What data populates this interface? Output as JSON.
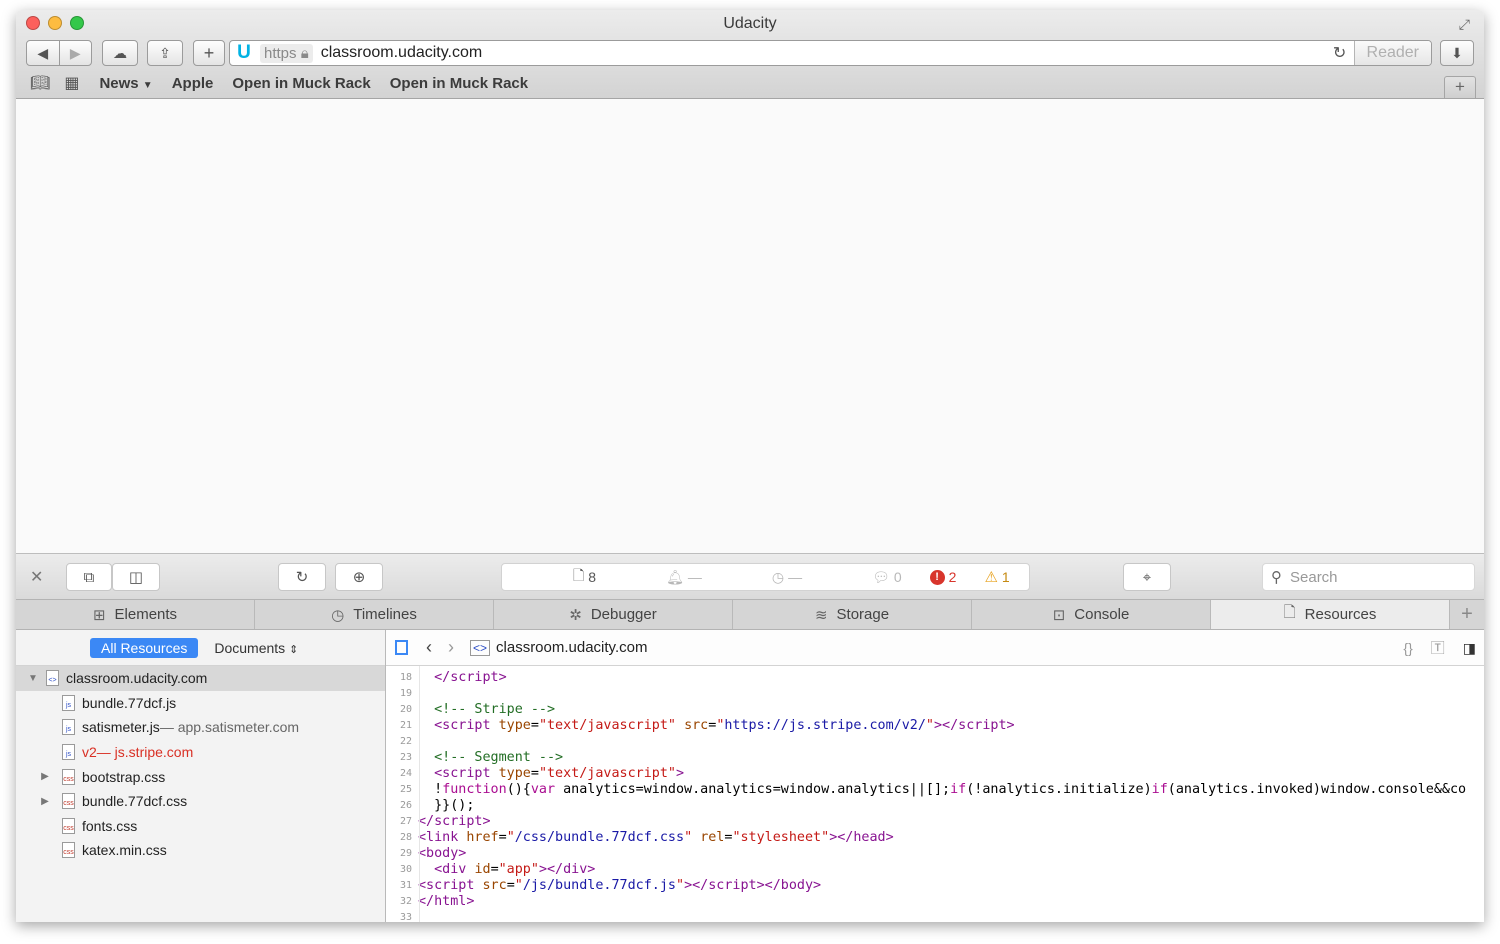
{
  "window": {
    "title": "Udacity",
    "colors": {
      "close": "#fc605c",
      "minimize": "#fdbc40",
      "zoom": "#34c84a"
    }
  },
  "toolbar": {
    "back_icon": "back-arrow-icon",
    "forward_icon": "forward-arrow-icon",
    "icloud_icon": "cloud-icon",
    "share_icon": "share-icon",
    "new_tab_icon": "plus-icon",
    "download_icon": "download-icon"
  },
  "address": {
    "scheme": "https",
    "url": "classroom.udacity.com",
    "reader_label": "Reader"
  },
  "bookmarks": {
    "items": [
      "News",
      "Apple",
      "Open in Muck Rack",
      "Open in Muck Rack"
    ]
  },
  "inspector": {
    "dashboard": {
      "resources": "8",
      "bytes": "—",
      "time": "—",
      "logs": "0",
      "errors": "2",
      "warnings": "1"
    },
    "search_placeholder": "Search",
    "tabs": [
      {
        "label": "Elements",
        "icon": "elements-icon"
      },
      {
        "label": "Timelines",
        "icon": "clock-icon"
      },
      {
        "label": "Debugger",
        "icon": "bug-icon"
      },
      {
        "label": "Storage",
        "icon": "database-icon"
      },
      {
        "label": "Console",
        "icon": "console-icon"
      },
      {
        "label": "Resources",
        "icon": "document-icon"
      }
    ],
    "active_tab": "Resources"
  },
  "sidebar": {
    "filter_all": "All Resources",
    "filter_docs": "Documents",
    "tree": [
      {
        "label": "classroom.udacity.com",
        "sub": "",
        "type": "doc",
        "expanded": true
      },
      {
        "label": "bundle.77dcf.js",
        "sub": "",
        "type": "js"
      },
      {
        "label": "satismeter.js",
        "sub": " — app.satismeter.com",
        "type": "js"
      },
      {
        "label": "v2",
        "sub": " — js.stripe.com",
        "type": "js",
        "error": true
      },
      {
        "label": "bootstrap.css",
        "sub": "",
        "type": "css",
        "collapsed": true
      },
      {
        "label": "bundle.77dcf.css",
        "sub": "",
        "type": "css",
        "collapsed": true
      },
      {
        "label": "fonts.css",
        "sub": "",
        "type": "css"
      },
      {
        "label": "katex.min.css",
        "sub": "",
        "type": "css"
      }
    ]
  },
  "source": {
    "file": "classroom.udacity.com",
    "lines": [
      {
        "n": "18",
        "html": "  <span class=\"t-tag\">&lt;/script&gt;</span>"
      },
      {
        "n": "19",
        "html": ""
      },
      {
        "n": "20",
        "html": "  <span class=\"t-com\">&lt;!-- Stripe --&gt;</span>"
      },
      {
        "n": "21",
        "html": "  <span class=\"t-tag\">&lt;script</span> <span class=\"t-attr\">type</span>=<span class=\"t-val\">\"text/javascript\"</span> <span class=\"t-attr\">src</span>=<span class=\"t-val\">\"</span><span class=\"t-str\">https://js.stripe.com/v2/</span><span class=\"t-val\">\"</span><span class=\"t-tag\">&gt;&lt;/script&gt;</span>"
      },
      {
        "n": "22",
        "html": ""
      },
      {
        "n": "23",
        "html": "  <span class=\"t-com\">&lt;!-- Segment --&gt;</span>"
      },
      {
        "n": "24",
        "html": "  <span class=\"t-tag\">&lt;script</span> <span class=\"t-attr\">type</span>=<span class=\"t-val\">\"text/javascript\"</span><span class=\"t-tag\">&gt;</span>"
      },
      {
        "n": "25",
        "html": "  !<span class=\"t-kw\">function</span>(){<span class=\"t-kw\">var</span> analytics=window.analytics=window.analytics||[];<span class=\"t-kw\">if</span>(!analytics.initialize)<span class=\"t-kw\">if</span>(analytics.invoked)window.console&amp;&amp;co"
      },
      {
        "n": "26",
        "html": "  }}();"
      },
      {
        "n": "27",
        "html": "<span class=\"t-tag\">&lt;/script&gt;</span>"
      },
      {
        "n": "28",
        "html": "<span class=\"t-tag\">&lt;link</span> <span class=\"t-attr\">href</span>=<span class=\"t-val\">\"</span><span class=\"t-str\">/css/bundle.77dcf.css</span><span class=\"t-val\">\"</span> <span class=\"t-attr\">rel</span>=<span class=\"t-val\">\"stylesheet\"</span><span class=\"t-tag\">&gt;&lt;/head&gt;</span>"
      },
      {
        "n": "29",
        "html": "<span class=\"t-tag\">&lt;body&gt;</span>"
      },
      {
        "n": "30",
        "html": "  <span class=\"t-tag\">&lt;div</span> <span class=\"t-attr\">id</span>=<span class=\"t-val\">\"app\"</span><span class=\"t-tag\">&gt;&lt;/div&gt;</span>"
      },
      {
        "n": "31",
        "html": "<span class=\"t-tag\">&lt;script</span> <span class=\"t-attr\">src</span>=<span class=\"t-val\">\"</span><span class=\"t-str\">/js/bundle.77dcf.js</span><span class=\"t-val\">\"</span><span class=\"t-tag\">&gt;&lt;/script&gt;&lt;/body&gt;</span>"
      },
      {
        "n": "32",
        "html": "<span class=\"t-tag\">&lt;/html&gt;</span>"
      },
      {
        "n": "33",
        "html": ""
      }
    ]
  }
}
